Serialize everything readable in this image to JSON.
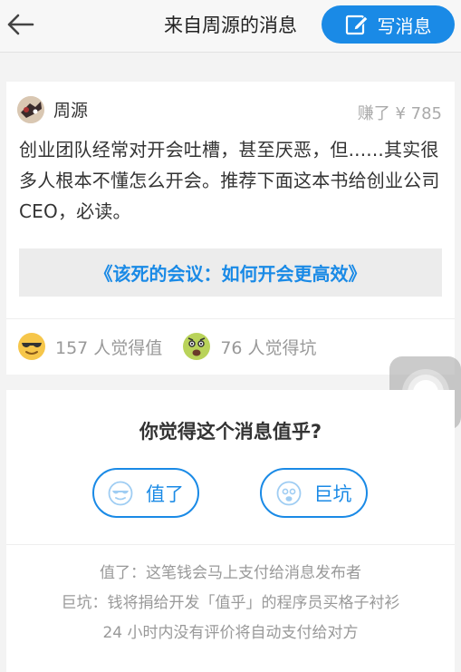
{
  "nav": {
    "title": "来自周源的消息",
    "compose_label": "写消息",
    "back_icon": "back-arrow-icon",
    "compose_icon": "edit-icon"
  },
  "message": {
    "author": "周源",
    "earned": "赚了 ¥ 785",
    "body": "创业团队经常对开会吐槽，甚至厌恶，但......其实很多人根本不懂怎么开会。推荐下面这本书给创业公司 CEO，必读。",
    "book": "《该死的会议：如何开会更高效》",
    "worth_count": "157 人觉得值",
    "pit_count": "76 人觉得坑"
  },
  "judge": {
    "question": "你觉得这个消息值乎?",
    "worth_label": "值了",
    "pit_label": "巨坑",
    "notes": [
      "值了：这笔钱会马上支付给消息发布者",
      "巨坑：钱将捐给开发「值乎」的程序员买格子衬衫",
      "24 小时内没有评价将自动支付给对方"
    ]
  },
  "colors": {
    "accent": "#1a8ae6",
    "emoji_yellow": "#f6c64a",
    "muted_text": "#999999"
  }
}
